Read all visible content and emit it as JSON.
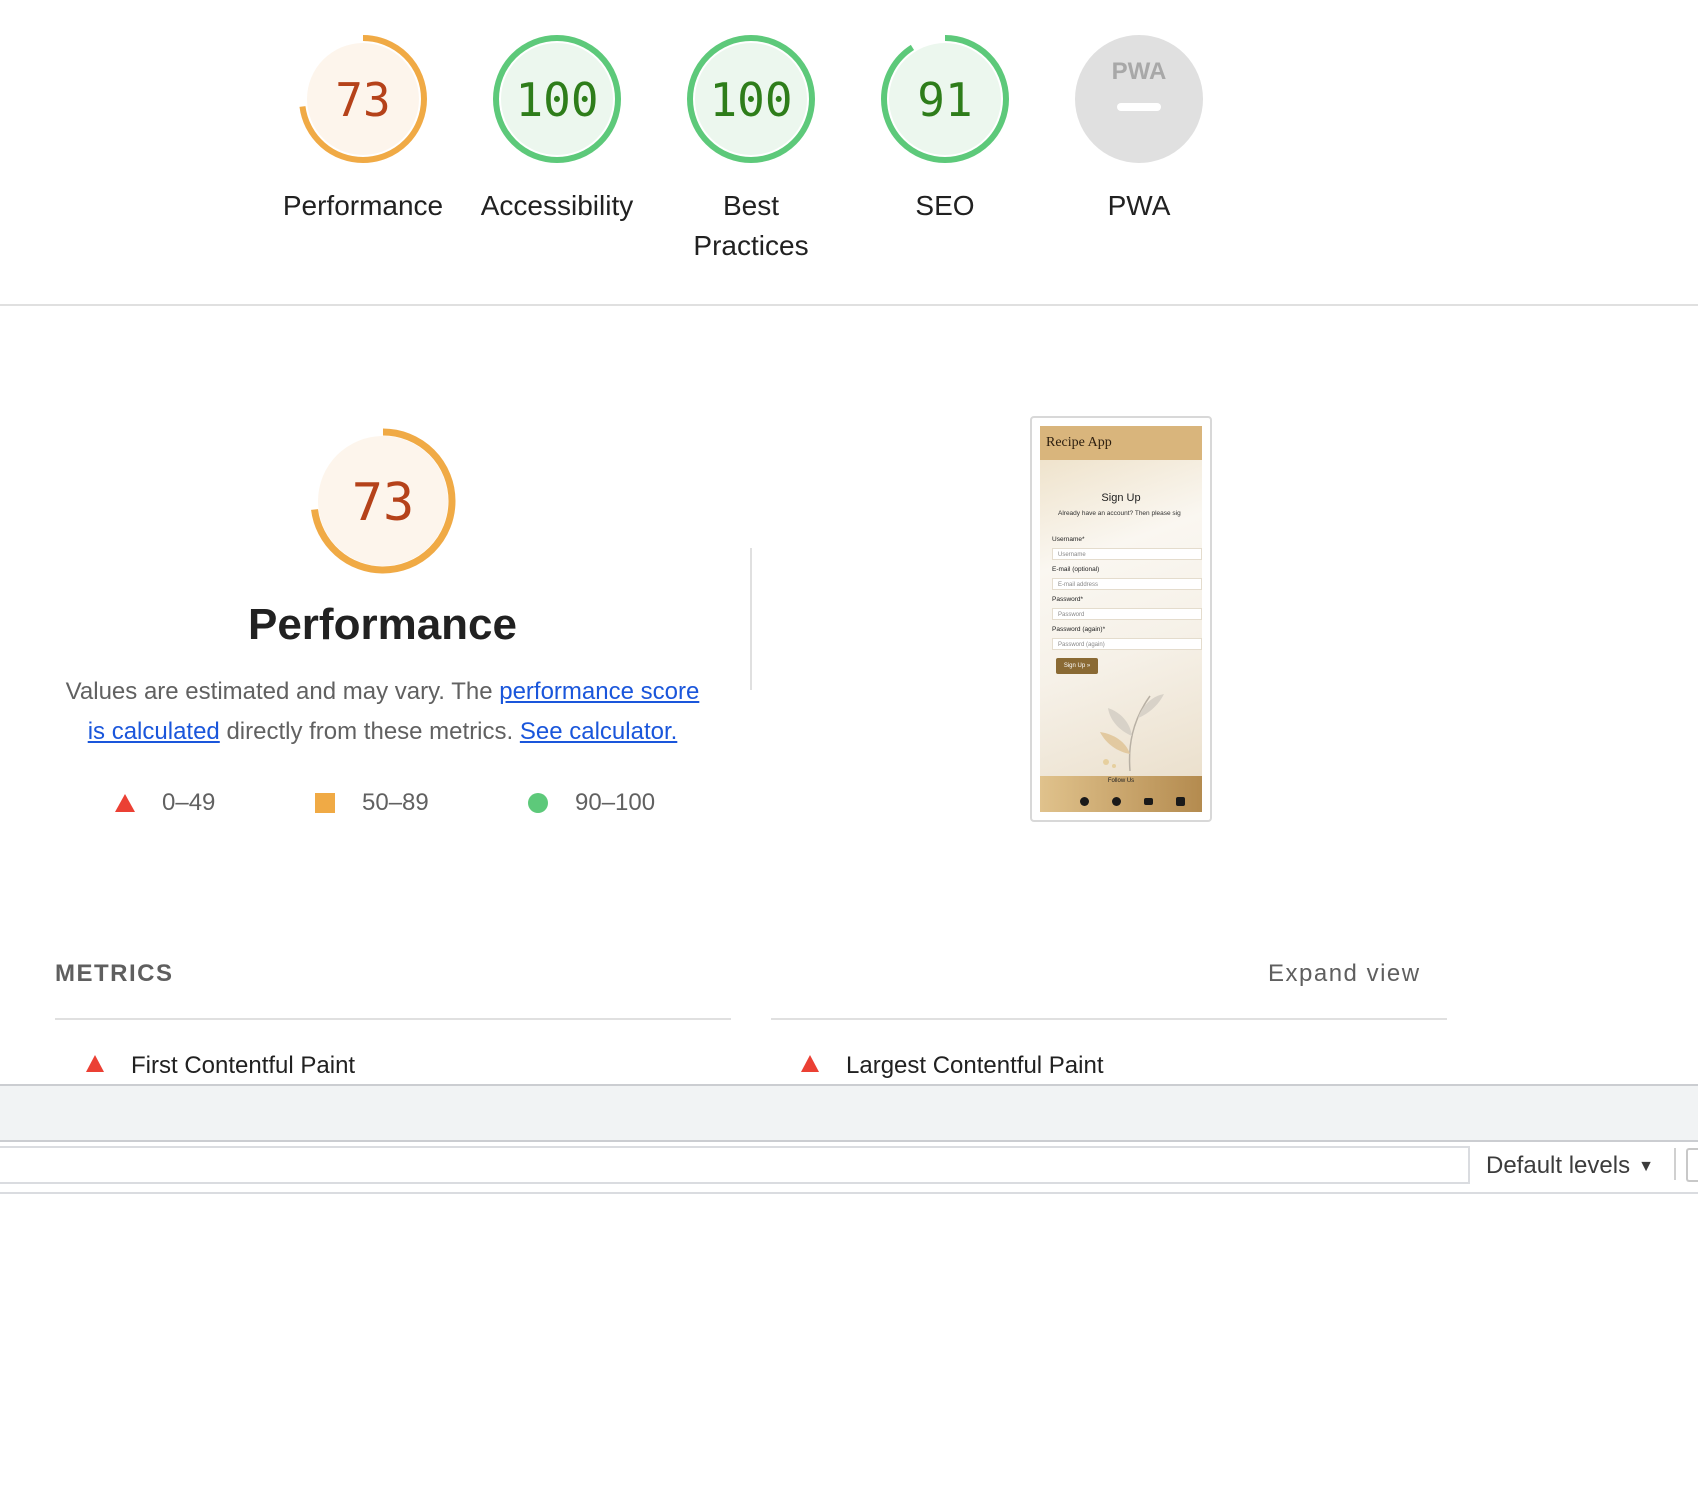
{
  "categories": [
    {
      "label": "Performance",
      "score": "73",
      "value": 0.73,
      "status": "average"
    },
    {
      "label": "Accessibility",
      "score": "100",
      "value": 1.0,
      "status": "pass"
    },
    {
      "label": "Best Practices",
      "score": "100",
      "value": 1.0,
      "status": "pass"
    },
    {
      "label": "SEO",
      "score": "91",
      "value": 0.91,
      "status": "pass"
    },
    {
      "label": "PWA",
      "score": "PWA",
      "status": "na"
    }
  ],
  "colors": {
    "average_arc": "#f0aa45",
    "average_bg": "#fdf5ec",
    "average_text": "#b5421a",
    "pass_arc": "#5dc97a",
    "pass_bg": "#ecf7ee",
    "pass_text": "#2e7d1a",
    "fail": "#eb4034",
    "na_bg": "#e0e0e0",
    "link": "#1a56db"
  },
  "performance": {
    "score": "73",
    "value": 0.73,
    "title": "Performance",
    "desc_prefix": "Values are estimated and may vary. The ",
    "link_score": "performance score is calculated",
    "desc_middle": " directly from these metrics. ",
    "link_calc": "See calculator."
  },
  "legend": [
    {
      "range": "0–49",
      "shape": "triangle",
      "color": "#eb4034"
    },
    {
      "range": "50–89",
      "shape": "square",
      "color": "#f0aa45"
    },
    {
      "range": "90–100",
      "shape": "circle",
      "color": "#5dc97a"
    }
  ],
  "screenshot": {
    "app_title": "Recipe App",
    "heading": "Sign Up",
    "subtext": "Already have an account? Then please sig",
    "fields": [
      {
        "label": "Username*",
        "placeholder": "Username"
      },
      {
        "label": "E-mail (optional)",
        "placeholder": "E-mail address"
      },
      {
        "label": "Password*",
        "placeholder": "Password"
      },
      {
        "label": "Password (again)*",
        "placeholder": "Password (again)"
      }
    ],
    "button": "Sign Up »",
    "footer": "Follow Us",
    "footer_icons": [
      "twitter-icon",
      "facebook-icon",
      "youtube-icon",
      "instagram-icon"
    ]
  },
  "metrics": {
    "heading": "METRICS",
    "expand": "Expand view",
    "items": [
      {
        "label": "First Contentful Paint",
        "status": "fail"
      },
      {
        "label": "Largest Contentful Paint",
        "status": "fail"
      }
    ]
  },
  "console": {
    "levels_label": "Default levels"
  }
}
